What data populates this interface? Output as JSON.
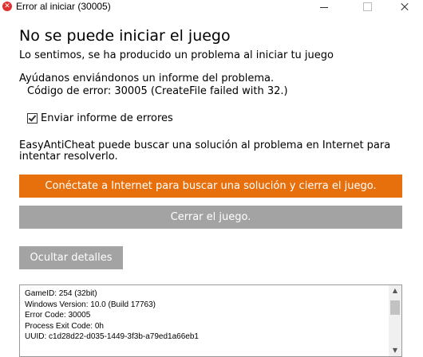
{
  "window": {
    "title": "Error al iniciar (30005)",
    "icon": "error-x-icon"
  },
  "content": {
    "heading": "No se puede iniciar el juego",
    "sorry": "Lo sentimos, se ha producido un problema al iniciar tu juego",
    "help": "Ayúdanos enviándonos un informe del problema.",
    "error_code": "Código de error: 30005 (CreateFile failed with 32.)",
    "send_report_label": "Enviar informe de errores",
    "send_report_checked": true,
    "eac_line1": "EasyAntiCheat puede buscar una solución al problema en Internet para",
    "eac_line2": "intentar resolverlo."
  },
  "buttons": {
    "connect": "Conéctate a Internet para buscar una solución y cierra el juego.",
    "close_game": "Cerrar el juego.",
    "hide_details": "Ocultar detalles"
  },
  "details": {
    "lines": [
      "GameID: 254 (32bit)",
      "Windows Version: 10.0 (Build 17763)",
      "Error Code: 30005",
      "Process Exit Code: 0h",
      "UUID: c1d28d22-d035-1449-3f3b-a79ed1a66eb1"
    ]
  },
  "colors": {
    "accent": "#e8700c",
    "button_gray": "#a3a3a3",
    "error_icon": "#e03131"
  }
}
